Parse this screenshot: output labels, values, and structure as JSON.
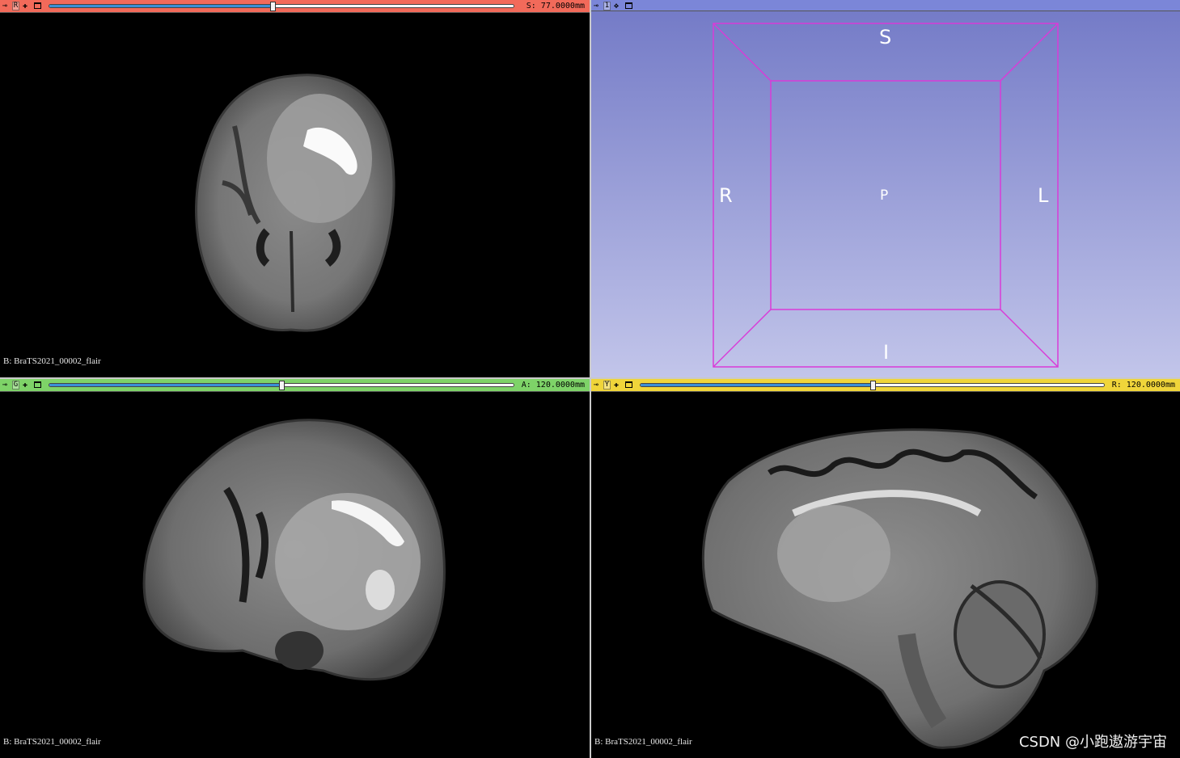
{
  "views": {
    "red": {
      "bar_color": "#f26a5a",
      "letter": "R",
      "offset_label": "S: 77.0000mm",
      "slider_position": 0.48,
      "volume_label": "B: BraTS2021_00002_flair"
    },
    "threed": {
      "bar_color": "#7b86d8",
      "letter": "1",
      "orient": {
        "S": "S",
        "R": "R",
        "L": "L",
        "P": "P",
        "I": "I"
      },
      "box_color": "#d93bd8"
    },
    "green": {
      "bar_color": "#7ed368",
      "letter": "G",
      "offset_label": "A: 120.0000mm",
      "slider_position": 0.5,
      "volume_label": "B: BraTS2021_00002_flair"
    },
    "yellow": {
      "bar_color": "#f0d53a",
      "letter": "Y",
      "offset_label": "R: 120.0000mm",
      "slider_position": 0.5,
      "volume_label": "B: BraTS2021_00002_flair"
    }
  },
  "watermark": "CSDN @小跑遨游宇宙"
}
